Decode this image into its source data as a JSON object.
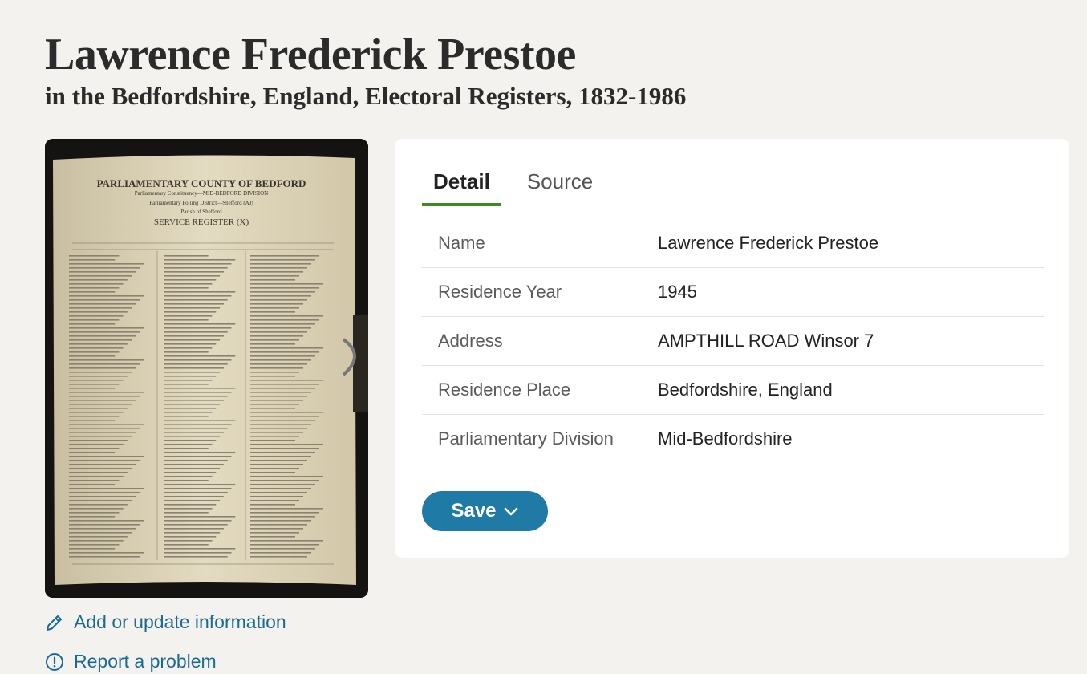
{
  "header": {
    "title": "Lawrence Frederick Prestoe",
    "subtitle": "in the Bedfordshire, England, Electoral Registers, 1832-1986"
  },
  "record_image": {
    "heading": "PARLIAMENTARY COUNTY OF BEDFORD",
    "line1": "Parliamentary Constituency—MID-BEDFORD DIVISION",
    "line2": "Parliamentary Polling District—Shefford (AJ)",
    "line3": "Parish of Shefford",
    "register": "SERVICE REGISTER (X)"
  },
  "links": {
    "add_update": "Add or update information",
    "report": "Report a problem"
  },
  "tabs": [
    {
      "label": "Detail",
      "active": true
    },
    {
      "label": "Source",
      "active": false
    }
  ],
  "facts": [
    {
      "label": "Name",
      "value": "Lawrence Frederick Prestoe"
    },
    {
      "label": "Residence Year",
      "value": "1945"
    },
    {
      "label": "Address",
      "value": "AMPTHILL ROAD Winsor 7"
    },
    {
      "label": "Residence Place",
      "value": "Bedfordshire, England"
    },
    {
      "label": "Parliamentary Division",
      "value": "Mid-Bedfordshire"
    }
  ],
  "actions": {
    "save_label": "Save"
  },
  "colors": {
    "background": "#f4f2ef",
    "link": "#1a6b8f",
    "save_button": "#1f7aa6",
    "active_tab_underline": "#3d8a1f"
  },
  "icons": {
    "add_update": "pencil-icon",
    "report": "alert-circle-icon",
    "save": "chevron-down-icon"
  }
}
